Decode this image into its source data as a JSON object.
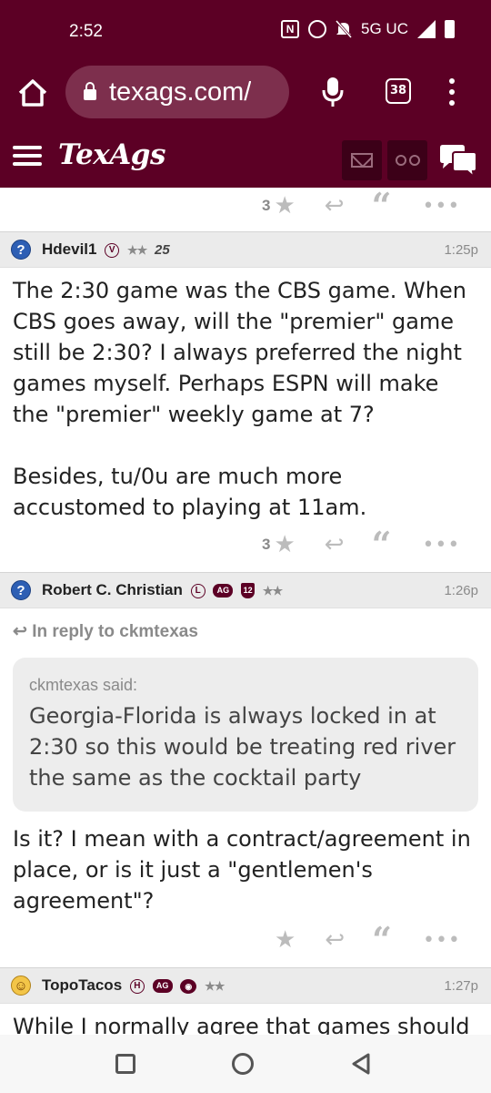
{
  "status_bar": {
    "time": "2:52",
    "network": "5G UC"
  },
  "browser": {
    "url": "texags.com/",
    "tab_count": "38"
  },
  "site": {
    "logo": "TexAgs"
  },
  "prev_post": {
    "likes": "3"
  },
  "posts": [
    {
      "author": "Hdevil1",
      "badges": [
        "V",
        "★★",
        "25"
      ],
      "time": "1:25p",
      "body": "The 2:30 game was the CBS game. When CBS goes away, will the \"premier\" game still be 2:30? I always preferred the night games myself. Perhaps ESPN will make the \"premier\" weekly game at 7?\n\nBesides, tu/0u are much more accustomed to playing at 11am.",
      "likes": "3"
    },
    {
      "author": "Robert C. Christian",
      "badges": [
        "L",
        "AG",
        "12",
        "★★"
      ],
      "time": "1:26p",
      "in_reply_to": "In reply to ckmtexas",
      "quote_author": "ckmtexas said:",
      "quote_text": "Georgia-Florida is always locked in at 2:30 so this would be treating red river the same as the cocktail party",
      "body": "Is it? I mean with a contract/agreement in place, or is it just a \"gentlemen's agreement\"?",
      "likes": ""
    },
    {
      "author": "TopoTacos",
      "badges": [
        "H",
        "AG",
        "★★"
      ],
      "time": "1:27p",
      "body": "While I normally agree that games should"
    }
  ]
}
